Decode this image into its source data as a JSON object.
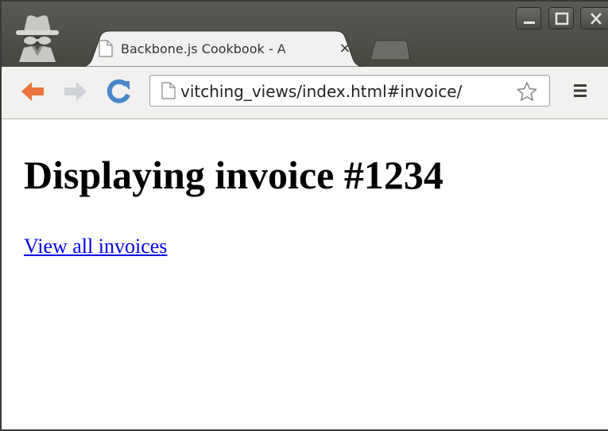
{
  "browser": {
    "tab": {
      "title": "Backbone.js Cookbook - A",
      "close_glyph": "×",
      "favicon": "page-icon"
    },
    "toolbar": {
      "url": "vitching_views/index.html#invoice/",
      "back_icon": "arrow-left-icon",
      "forward_icon": "arrow-right-icon",
      "reload_icon": "reload-icon",
      "bookmark_icon": "star-icon",
      "menu_icon": "hamburger-menu-icon"
    },
    "window_controls": [
      "minimize-icon",
      "maximize-icon",
      "close-icon"
    ],
    "profile_icon": "incognito-icon"
  },
  "page": {
    "heading": "Displaying invoice #1234",
    "link_label": "View all invoices"
  },
  "colors": {
    "titlebar": "#4f4e49",
    "toolbar": "#f2f1f0",
    "back_arrow": "#e8743b",
    "reload": "#4a86c8",
    "link": "#0000ee"
  }
}
